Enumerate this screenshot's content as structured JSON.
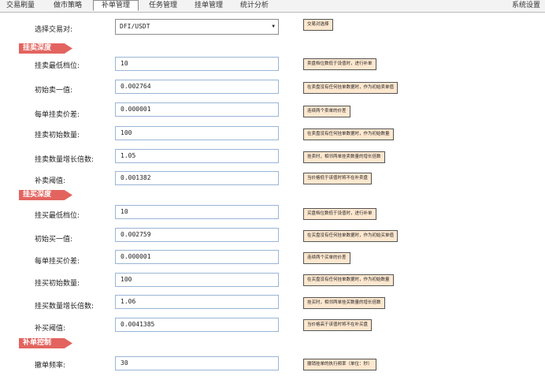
{
  "tabs": [
    {
      "label": "交易刷量",
      "active": false
    },
    {
      "label": "做市策略",
      "active": false
    },
    {
      "label": "补单管理",
      "active": true
    },
    {
      "label": "任务管理",
      "active": false
    },
    {
      "label": "挂单管理",
      "active": false
    },
    {
      "label": "统计分析",
      "active": false
    }
  ],
  "settings_label": "系统设置",
  "pair": {
    "label": "选择交易对:",
    "value": "DFI/USDT",
    "hint": "交易对选择"
  },
  "sell_depth": {
    "title": "挂卖深度",
    "rows": [
      {
        "label": "挂卖最低档位:",
        "value": "10",
        "hint": "卖盘档位数低于设值时，进行补单"
      },
      {
        "label": "初始卖一值:",
        "value": "0.002764",
        "hint": "在卖盘没有任何挂单数据时，作为初始卖单值"
      },
      {
        "label": "每单挂卖价差:",
        "value": "0.000001",
        "hint": "连续两个卖单的价差"
      },
      {
        "label": "挂卖初始数量:",
        "value": "100",
        "hint": "在卖盘没有任何挂单数据时，作为初始数量"
      },
      {
        "label": "挂卖数量增长倍数:",
        "value": "1.05",
        "hint": "挂卖时，相邻两单挂卖数量的增长倍数"
      },
      {
        "label": "补卖阈值:",
        "value": "0.001382",
        "hint": "当价格低于该值时将不在补卖盘"
      }
    ]
  },
  "buy_depth": {
    "title": "挂买深度",
    "rows": [
      {
        "label": "挂买最低档位:",
        "value": "10",
        "hint": "买盘档位数低于设值时，进行补单"
      },
      {
        "label": "初始买一值:",
        "value": "0.002759",
        "hint": "在买盘没有任何挂单数据时，作为初始买单值"
      },
      {
        "label": "每单挂买价差:",
        "value": "0.000001",
        "hint": "连续两个买单的价差"
      },
      {
        "label": "挂买初始数量:",
        "value": "100",
        "hint": "在买盘没有任何挂单数据时，作为初始数量"
      },
      {
        "label": "挂买数量增长倍数:",
        "value": "1.06",
        "hint": "挂买时，相邻两单挂买数量的增长倍数"
      },
      {
        "label": "补买阈值:",
        "value": "0.0041385",
        "hint": "当价格高于该值时将不在补买盘"
      }
    ]
  },
  "control": {
    "title": "补单控制",
    "rows": [
      {
        "label": "撤单频率:",
        "value": "30",
        "hint": "撤销挂单的执行频率（单位：秒）"
      }
    ]
  }
}
